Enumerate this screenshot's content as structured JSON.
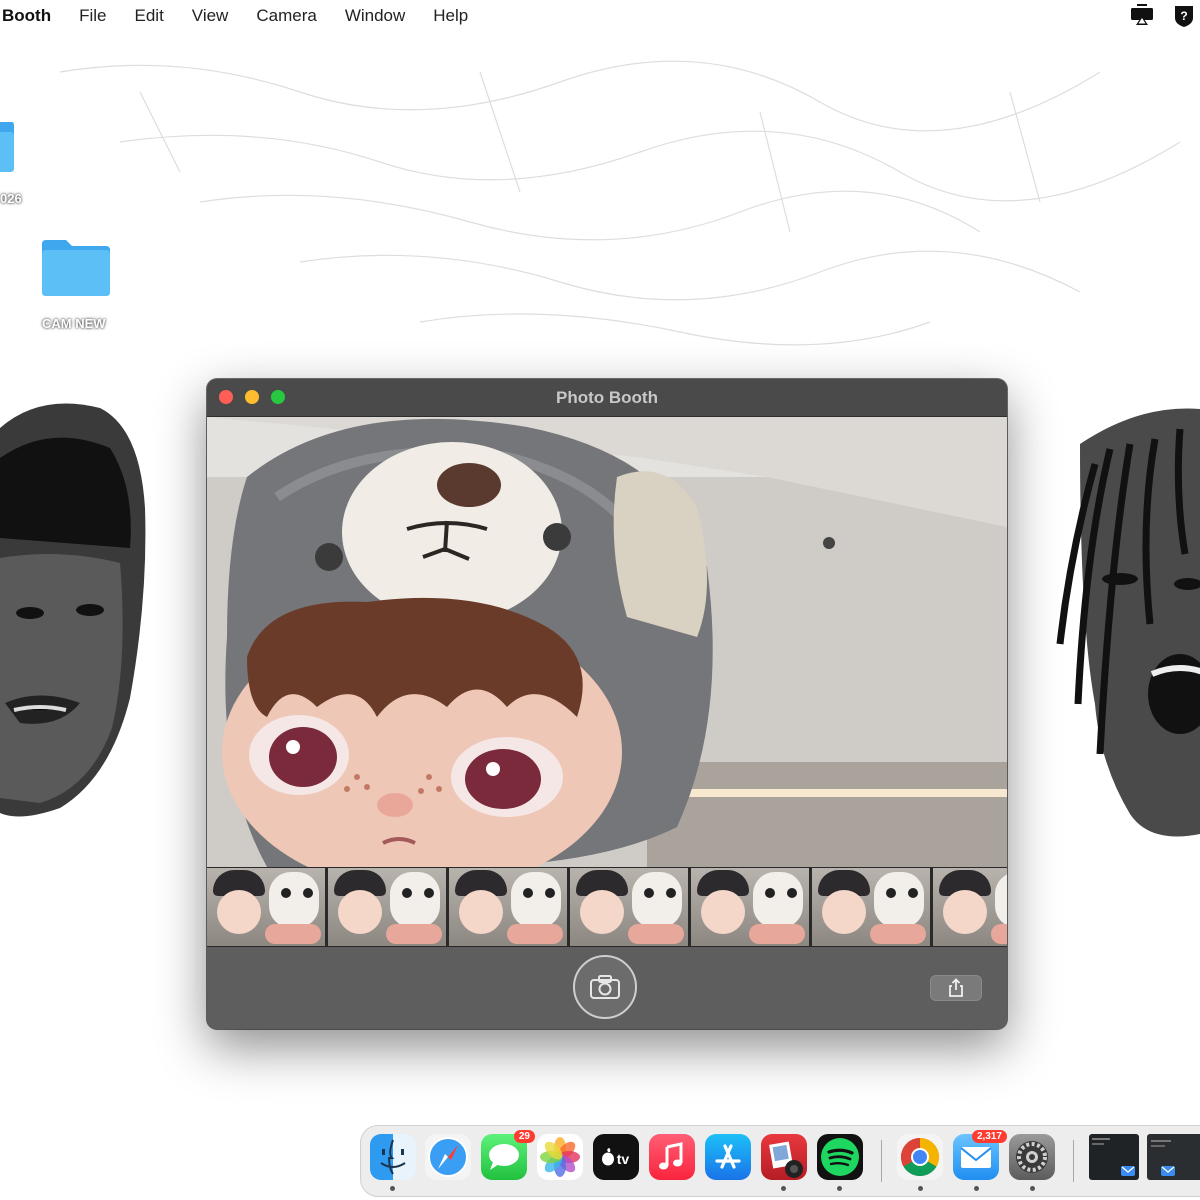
{
  "menubar": {
    "app_name": "Booth",
    "items": [
      "File",
      "Edit",
      "View",
      "Camera",
      "Window",
      "Help"
    ],
    "right_icons": [
      "screen-mirroring-icon",
      "shield-question-icon"
    ]
  },
  "desktop": {
    "folders": [
      {
        "label": "026",
        "icon": "folder-icon"
      },
      {
        "label": "CAM NEW",
        "icon": "folder-icon"
      }
    ]
  },
  "window": {
    "title": "Photo Booth",
    "thumbnail_count": 7,
    "shutter_icon": "camera-icon",
    "share_icon": "share-icon"
  },
  "dock": {
    "apps": [
      {
        "name": "Finder",
        "icon": "finder-icon",
        "running": true
      },
      {
        "name": "Safari",
        "icon": "safari-icon",
        "running": false
      },
      {
        "name": "Messages",
        "icon": "messages-icon",
        "badge": "29",
        "running": false
      },
      {
        "name": "Photos",
        "icon": "photos-icon",
        "running": false
      },
      {
        "name": "Apple TV",
        "icon": "apple-tv-icon",
        "label": "tv",
        "running": false
      },
      {
        "name": "Music",
        "icon": "music-icon",
        "running": false
      },
      {
        "name": "App Store",
        "icon": "app-store-icon",
        "running": false
      },
      {
        "name": "Photo Booth",
        "icon": "photo-booth-icon",
        "running": true
      },
      {
        "name": "Spotify",
        "icon": "spotify-icon",
        "running": true
      },
      {
        "name": "Chrome",
        "icon": "chrome-icon",
        "running": true
      },
      {
        "name": "Mail",
        "icon": "mail-icon",
        "badge": "2,317",
        "running": true
      },
      {
        "name": "System Settings",
        "icon": "settings-gear-icon",
        "running": true
      }
    ]
  },
  "colors": {
    "folder_blue": "#4fb3f0",
    "window_bg": "#5b5b5b",
    "badge_red": "#ff3b30"
  }
}
